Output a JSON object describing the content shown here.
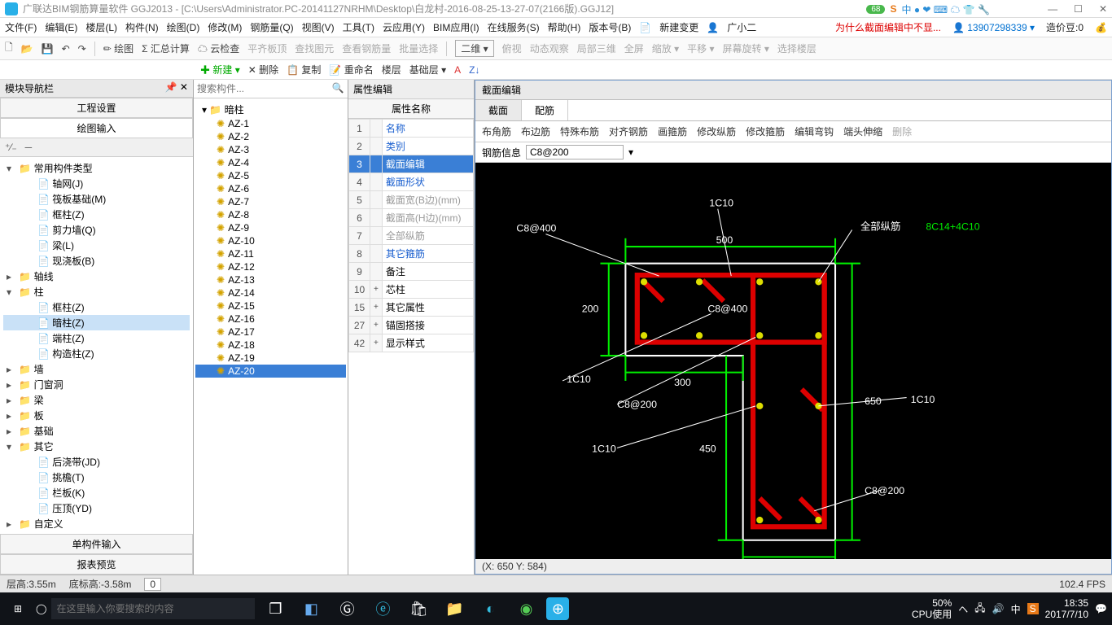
{
  "title": "广联达BIM钢筋算量软件 GGJ2013 - [C:\\Users\\Administrator.PC-20141127NRHM\\Desktop\\白龙村-2016-08-25-13-27-07(2166版).GGJ12]",
  "ime": {
    "badge": "68",
    "items": "中 ● ❤ ⌨ ☁ 👕 🔧"
  },
  "menubar": [
    "文件(F)",
    "编辑(E)",
    "楼层(L)",
    "构件(N)",
    "绘图(D)",
    "修改(M)",
    "钢筋量(Q)",
    "视图(V)",
    "工具(T)",
    "云应用(Y)",
    "BIM应用(I)",
    "在线服务(S)",
    "帮助(H)",
    "版本号(B)"
  ],
  "menubar_right": {
    "new_change": "新建变更",
    "user": "广小二",
    "warn": "为什么截面编辑中不显...",
    "account": "13907298339",
    "coin_label": "造价豆:0"
  },
  "toolbar1": [
    "绘图",
    "汇总计算",
    "云检查",
    "平齐板顶",
    "查找图元",
    "查看钢筋量",
    "批量选择",
    "二维",
    "俯视",
    "动态观察",
    "局部三维",
    "全屏",
    "缩放",
    "平移",
    "屏幕旋转",
    "选择楼层"
  ],
  "toolbar2": {
    "new": "新建",
    "del": "删除",
    "copy": "复制",
    "rename": "重命名",
    "layer": "楼层",
    "found": "基础层"
  },
  "nav": {
    "title": "模块导航栏",
    "btn_proj": "工程设置",
    "btn_draw": "绘图输入",
    "categories": [
      {
        "t": "▾",
        "label": "常用构件类型",
        "children": [
          {
            "label": "轴网(J)"
          },
          {
            "label": "筏板基础(M)"
          },
          {
            "label": "框柱(Z)"
          },
          {
            "label": "剪力墙(Q)"
          },
          {
            "label": "梁(L)"
          },
          {
            "label": "现浇板(B)"
          }
        ]
      },
      {
        "t": "▸",
        "label": "轴线"
      },
      {
        "t": "▾",
        "label": "柱",
        "children": [
          {
            "label": "框柱(Z)"
          },
          {
            "label": "暗柱(Z)",
            "hl": true
          },
          {
            "label": "端柱(Z)"
          },
          {
            "label": "构造柱(Z)"
          }
        ]
      },
      {
        "t": "▸",
        "label": "墙"
      },
      {
        "t": "▸",
        "label": "门窗洞"
      },
      {
        "t": "▸",
        "label": "梁"
      },
      {
        "t": "▸",
        "label": "板"
      },
      {
        "t": "▸",
        "label": "基础"
      },
      {
        "t": "▾",
        "label": "其它",
        "children": [
          {
            "label": "后浇带(JD)"
          },
          {
            "label": "挑檐(T)"
          },
          {
            "label": "栏板(K)"
          },
          {
            "label": "压顶(YD)"
          }
        ]
      },
      {
        "t": "▸",
        "label": "自定义"
      }
    ],
    "bot1": "单构件输入",
    "bot2": "报表预览"
  },
  "complist": {
    "placeholder": "搜索构件...",
    "root": "暗柱",
    "items": [
      "AZ-1",
      "AZ-2",
      "AZ-3",
      "AZ-4",
      "AZ-5",
      "AZ-6",
      "AZ-7",
      "AZ-8",
      "AZ-9",
      "AZ-10",
      "AZ-11",
      "AZ-12",
      "AZ-13",
      "AZ-14",
      "AZ-15",
      "AZ-16",
      "AZ-17",
      "AZ-18",
      "AZ-19",
      "AZ-20"
    ],
    "selected": "AZ-20"
  },
  "props": {
    "title": "属性编辑",
    "head": "属性名称",
    "rows": [
      {
        "n": "1",
        "name": "名称",
        "cls": "blue"
      },
      {
        "n": "2",
        "name": "类别",
        "cls": "blue"
      },
      {
        "n": "3",
        "name": "截面编辑",
        "cls": "sel"
      },
      {
        "n": "4",
        "name": "截面形状",
        "cls": "blue"
      },
      {
        "n": "5",
        "name": "截面宽(B边)(mm)",
        "cls": "gray"
      },
      {
        "n": "6",
        "name": "截面高(H边)(mm)",
        "cls": "gray"
      },
      {
        "n": "7",
        "name": "全部纵筋",
        "cls": "gray"
      },
      {
        "n": "8",
        "name": "其它箍筋",
        "cls": "blue"
      },
      {
        "n": "9",
        "name": "备注",
        "cls": ""
      },
      {
        "n": "10",
        "name": "芯柱",
        "plus": "+"
      },
      {
        "n": "15",
        "name": "其它属性",
        "plus": "+"
      },
      {
        "n": "27",
        "name": "锚固搭接",
        "plus": "+"
      },
      {
        "n": "42",
        "name": "显示样式",
        "plus": "+"
      }
    ]
  },
  "section": {
    "title": "截面编辑",
    "tab1": "截面",
    "tab2": "配筋",
    "subbar": [
      "布角筋",
      "布边筋",
      "特殊布筋",
      "对齐钢筋",
      "画箍筋",
      "修改纵筋",
      "修改箍筋",
      "编辑弯钩",
      "端头伸缩",
      "删除"
    ],
    "info_label": "钢筋信息",
    "info_value": "C8@200",
    "status": "(X: 650 Y: 584)",
    "annot": {
      "c8400": "C8@400",
      "d500": "500",
      "d200": "200",
      "c8400b": "C8@400",
      "d300": "300",
      "c8200": "C8@200",
      "d650": "650",
      "d450": "450",
      "ic10": "1C10",
      "c8200b": "C8@200",
      "all_label": "全部纵筋",
      "all_val": "8C14+4C10"
    }
  },
  "statusbar": {
    "h": "层高:3.55m",
    "bh": "底标高:-3.58m",
    "zero": "0",
    "fps": "102.4 FPS"
  },
  "taskbar": {
    "search": "在这里输入你要搜索的内容",
    "cpu1": "50%",
    "cpu2": "CPU使用",
    "time": "18:35",
    "date": "2017/7/10"
  }
}
